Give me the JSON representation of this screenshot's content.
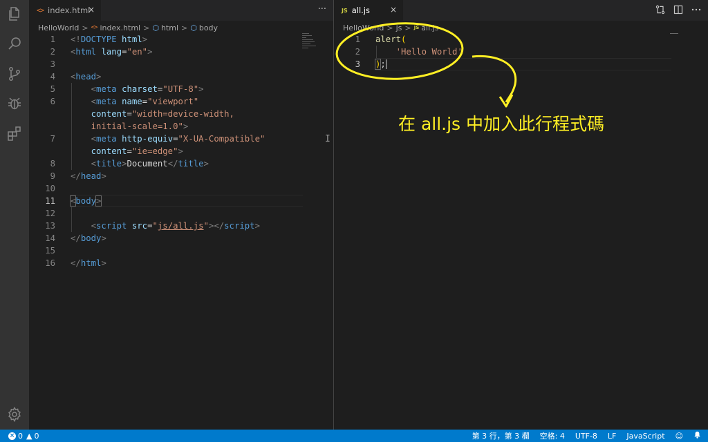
{
  "activity_bar": {
    "icons": [
      "files-icon",
      "search-icon",
      "source-control-icon",
      "debug-icon",
      "extensions-icon"
    ],
    "bottom_icon": "settings-gear-icon"
  },
  "left_editor": {
    "tab": {
      "label": "index.html",
      "close": "×"
    },
    "more_actions": "···",
    "breadcrumb": [
      "HelloWorld",
      "index.html",
      "html",
      "body"
    ],
    "active_line": 11
  },
  "right_editor": {
    "tab": {
      "label": "all.js",
      "close": "×",
      "icon_text": "JS"
    },
    "breadcrumb": [
      "HelloWorld",
      "js",
      "all.js"
    ],
    "actions": [
      "split-compare-icon",
      "split-editor-icon",
      "more-actions-icon"
    ],
    "active_line": 3
  },
  "annotation": {
    "text": "在 all.js 中加入此行程式碼",
    "color": "#ffef24"
  },
  "statusbar": {
    "errors": "0",
    "warnings": "0",
    "position": "第 3 行，第 3 欄",
    "indent": "空格: 4",
    "encoding": "UTF-8",
    "eol": "LF",
    "language": "JavaScript",
    "color": "#007acc"
  }
}
